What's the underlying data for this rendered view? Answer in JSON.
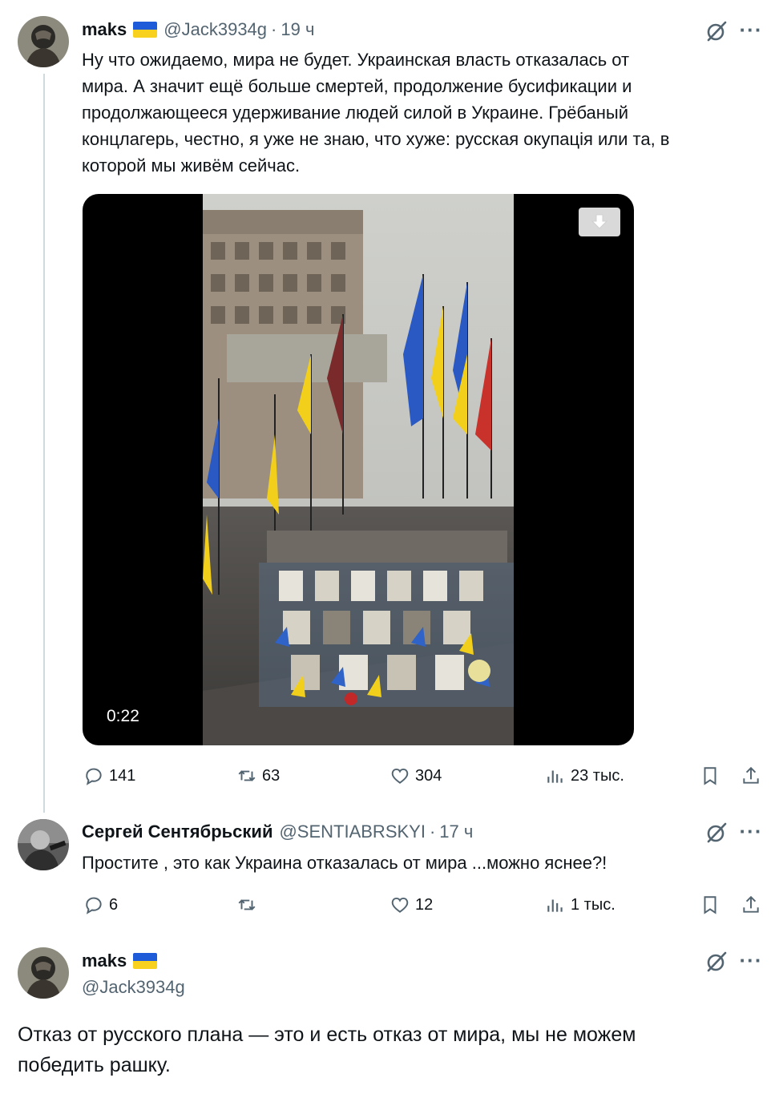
{
  "tweets": [
    {
      "name": "maks",
      "handle": "@Jack3934g",
      "time": "19 ч",
      "text": "Ну что ожидаемо, мира не будет. Украинская власть отказалась от мира. А значит ещё больше смертей, продолжение бусификации и продолжающееся удерживание людей силой в Украине. Грёбаный концлагерь, честно, я уже не знаю, что хуже: русская окупація или та, в которой мы живём сейчас.",
      "text_lines": [
        "Ну что ожидаемо, мира не будет. Украинская власть отказалась от",
        "мира. А значит ещё больше смертей, продолжение бусификации и",
        "продолжающееся удерживание людей силой в Украине. Грёбаный",
        "концлагерь, честно, я уже не знаю, что хуже: русская окупація или та, в",
        "которой мы живём сейчас."
      ],
      "video_duration": "0:22",
      "stats": {
        "replies": "141",
        "reposts": "63",
        "likes": "304",
        "views": "23 тыс."
      }
    },
    {
      "name": "Сергей Сентябрьский",
      "handle": "@SENTIABRSKYI",
      "time": "17 ч",
      "text": "Простите , это как Украина отказалась от мира ...можно яснее?!",
      "stats": {
        "replies": "6",
        "reposts": "",
        "likes": "12",
        "views": "1 тыс."
      }
    },
    {
      "name": "maks",
      "handle": "@Jack3934g",
      "text_lines": [
        "Отказ от русского плана — это и есть отказ от мира, мы не можем",
        "победить рашку."
      ]
    }
  ],
  "icons": {
    "reply": "reply-icon",
    "repost": "repost-icon",
    "like": "heart-icon",
    "views": "views-icon",
    "bookmark": "bookmark-icon",
    "share": "share-icon",
    "grok": "grok-icon",
    "more": "more-icon",
    "download": "download-icon"
  },
  "colors": {
    "text": "#0f1419",
    "secondary": "#536471",
    "flag_blue": "#1d5bd8",
    "flag_yellow": "#f7d11e"
  }
}
